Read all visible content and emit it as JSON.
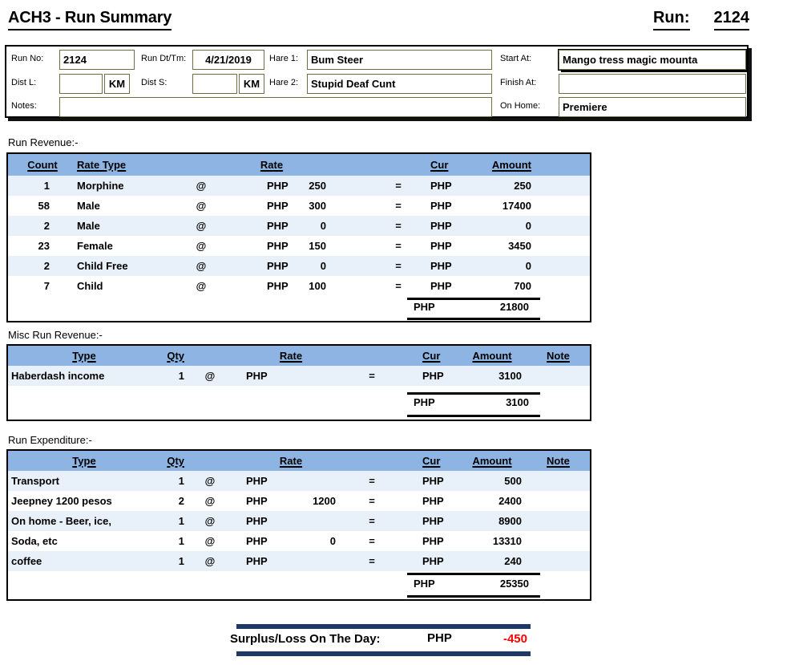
{
  "title": "ACH3 - Run Summary",
  "run": {
    "label": "Run:",
    "value": "2124"
  },
  "colors": {
    "header_blue": "#8DB4E2",
    "row_alt": "#E8F1F9",
    "bar_navy": "#1F3864",
    "negative_red": "#FF0000",
    "input_border": "#6E6F45"
  },
  "info": {
    "run_no": {
      "label": "Run No:",
      "value": "2124"
    },
    "run_dttm": {
      "label": "Run Dt/Tm:",
      "value": "4/21/2019"
    },
    "hare1": {
      "label": "Hare 1:",
      "value": "Bum Steer"
    },
    "start_at": {
      "label": "Start At:",
      "value": "Mango tress magic mounta"
    },
    "dist_l": {
      "label": "Dist L:",
      "value": "",
      "unit": "KM"
    },
    "dist_s": {
      "label": "Dist S:",
      "value": "",
      "unit": "KM"
    },
    "hare2": {
      "label": "Hare 2:",
      "value": "Stupid Deaf Cunt"
    },
    "finish_at": {
      "label": "Finish At:",
      "value": ""
    },
    "notes": {
      "label": "Notes:",
      "value": ""
    },
    "on_home": {
      "label": "On Home:",
      "value": "Premiere"
    }
  },
  "revenue": {
    "section_label": "Run Revenue:-",
    "headers": {
      "count": "Count",
      "rate_type": "Rate Type",
      "rate": "Rate",
      "cur": "Cur",
      "amount": "Amount"
    },
    "rows": [
      {
        "count": "1",
        "type": "Morphine",
        "at": "@",
        "rate_cur": "PHP",
        "rate": "250",
        "eq": "=",
        "cur": "PHP",
        "amount": "250"
      },
      {
        "count": "58",
        "type": "Male",
        "at": "@",
        "rate_cur": "PHP",
        "rate": "300",
        "eq": "=",
        "cur": "PHP",
        "amount": "17400"
      },
      {
        "count": "2",
        "type": "Male",
        "at": "@",
        "rate_cur": "PHP",
        "rate": "0",
        "eq": "=",
        "cur": "PHP",
        "amount": "0"
      },
      {
        "count": "23",
        "type": "Female",
        "at": "@",
        "rate_cur": "PHP",
        "rate": "150",
        "eq": "=",
        "cur": "PHP",
        "amount": "3450"
      },
      {
        "count": "2",
        "type": "Child Free",
        "at": "@",
        "rate_cur": "PHP",
        "rate": "0",
        "eq": "=",
        "cur": "PHP",
        "amount": "0"
      },
      {
        "count": "7",
        "type": "Child",
        "at": "@",
        "rate_cur": "PHP",
        "rate": "100",
        "eq": "=",
        "cur": "PHP",
        "amount": "700"
      }
    ],
    "total": {
      "cur": "PHP",
      "amount": "21800"
    }
  },
  "misc": {
    "section_label": "Misc Run Revenue:-",
    "headers": {
      "type": "Type",
      "qty": "Qty",
      "rate": "Rate",
      "cur": "Cur",
      "amount": "Amount",
      "note": "Note"
    },
    "rows": [
      {
        "type": "Haberdash income",
        "qty": "1",
        "at": "@",
        "rate_cur": "PHP",
        "rate": "",
        "eq": "=",
        "cur": "PHP",
        "amount": "3100",
        "note": ""
      }
    ],
    "total": {
      "cur": "PHP",
      "amount": "3100"
    }
  },
  "expenditure": {
    "section_label": "Run Expenditure:-",
    "headers": {
      "type": "Type",
      "qty": "Qty",
      "rate": "Rate",
      "cur": "Cur",
      "amount": "Amount",
      "note": "Note"
    },
    "rows": [
      {
        "type": "Transport",
        "qty": "1",
        "at": "@",
        "rate_cur": "PHP",
        "rate": "",
        "eq": "=",
        "cur": "PHP",
        "amount": "500",
        "note": ""
      },
      {
        "type": "Jeepney 1200 pesos",
        "qty": "2",
        "at": "@",
        "rate_cur": "PHP",
        "rate": "1200",
        "eq": "=",
        "cur": "PHP",
        "amount": "2400",
        "note": ""
      },
      {
        "type": "On home - Beer, ice,",
        "qty": "1",
        "at": "@",
        "rate_cur": "PHP",
        "rate": "",
        "eq": "=",
        "cur": "PHP",
        "amount": "8900",
        "note": ""
      },
      {
        "type": "Soda, etc",
        "qty": "1",
        "at": "@",
        "rate_cur": "PHP",
        "rate": "0",
        "eq": "=",
        "cur": "PHP",
        "amount": "13310",
        "note": ""
      },
      {
        "type": "coffee",
        "qty": "1",
        "at": "@",
        "rate_cur": "PHP",
        "rate": "",
        "eq": "=",
        "cur": "PHP",
        "amount": "240",
        "note": ""
      }
    ],
    "total": {
      "cur": "PHP",
      "amount": "25350"
    }
  },
  "surplus": {
    "label": "Surplus/Loss On The Day:",
    "cur": "PHP",
    "amount": "-450"
  }
}
